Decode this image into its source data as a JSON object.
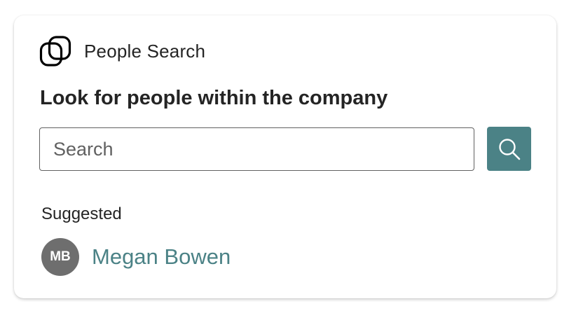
{
  "app": {
    "title": "People Search",
    "icon": "linked-loops-logo-icon"
  },
  "main": {
    "heading": "Look for people within the company"
  },
  "search": {
    "placeholder": "Search",
    "value": "",
    "button_icon": "search-icon"
  },
  "suggested": {
    "label": "Suggested",
    "people": [
      {
        "initials": "MB",
        "name": "Megan Bowen"
      }
    ]
  },
  "colors": {
    "accent": "#4b8286",
    "avatar_bg": "#6e6e6e",
    "text": "#242424"
  }
}
